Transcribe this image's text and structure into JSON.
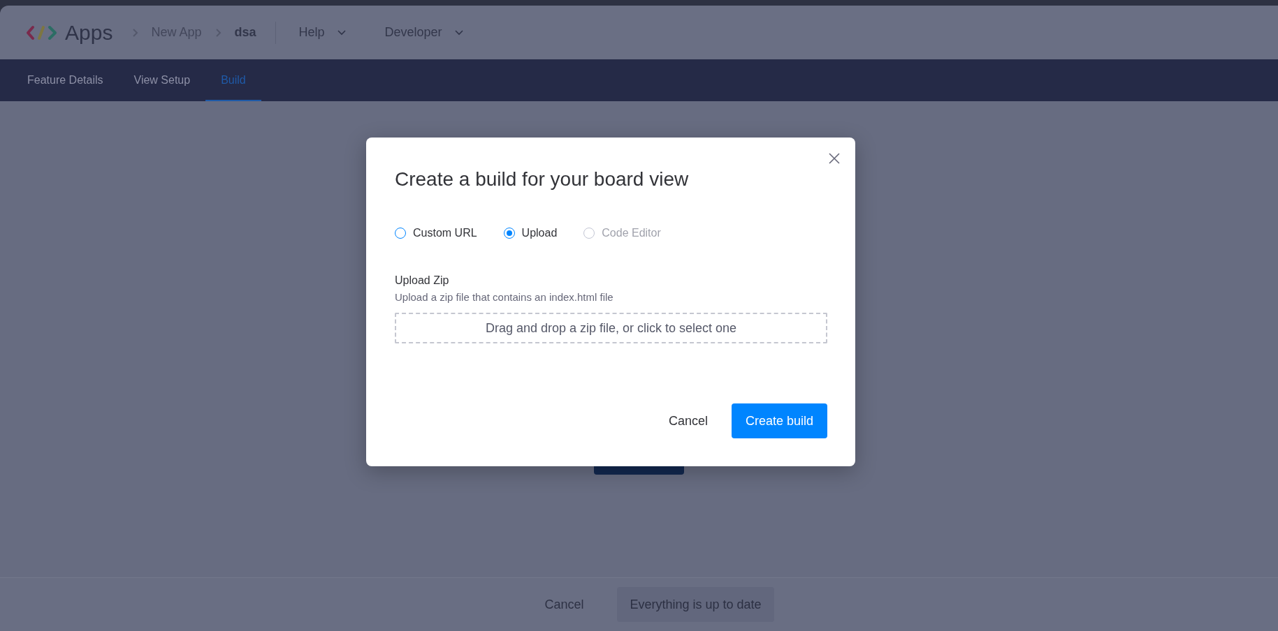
{
  "header": {
    "logo_text": "Apps",
    "breadcrumbs": [
      {
        "label": "New App",
        "current": false
      },
      {
        "label": "dsa",
        "current": true
      }
    ],
    "menus": [
      "Help",
      "Developer"
    ]
  },
  "tabs": [
    {
      "label": "Feature Details",
      "selected": false
    },
    {
      "label": "View Setup",
      "selected": false
    },
    {
      "label": "Build",
      "selected": true
    }
  ],
  "dialog": {
    "title": "Create a build for your board view",
    "options": [
      {
        "label": "Custom URL",
        "selected": false,
        "disabled": false
      },
      {
        "label": "Upload",
        "selected": true,
        "disabled": false
      },
      {
        "label": "Code Editor",
        "selected": false,
        "disabled": true
      }
    ],
    "upload": {
      "label": "Upload Zip",
      "description": "Upload a zip file that contains an index.html file",
      "dropzone": "Drag and drop a zip file, or click to select one"
    },
    "buttons": [
      {
        "label": "Cancel",
        "kind": "text"
      },
      {
        "label": "Create build",
        "kind": "primary"
      }
    ]
  },
  "footer": {
    "buttons": [
      {
        "label": "Cancel",
        "kind": "text",
        "disabled": false
      },
      {
        "label": "Everything is up to date",
        "kind": "primary",
        "disabled": true
      }
    ]
  }
}
